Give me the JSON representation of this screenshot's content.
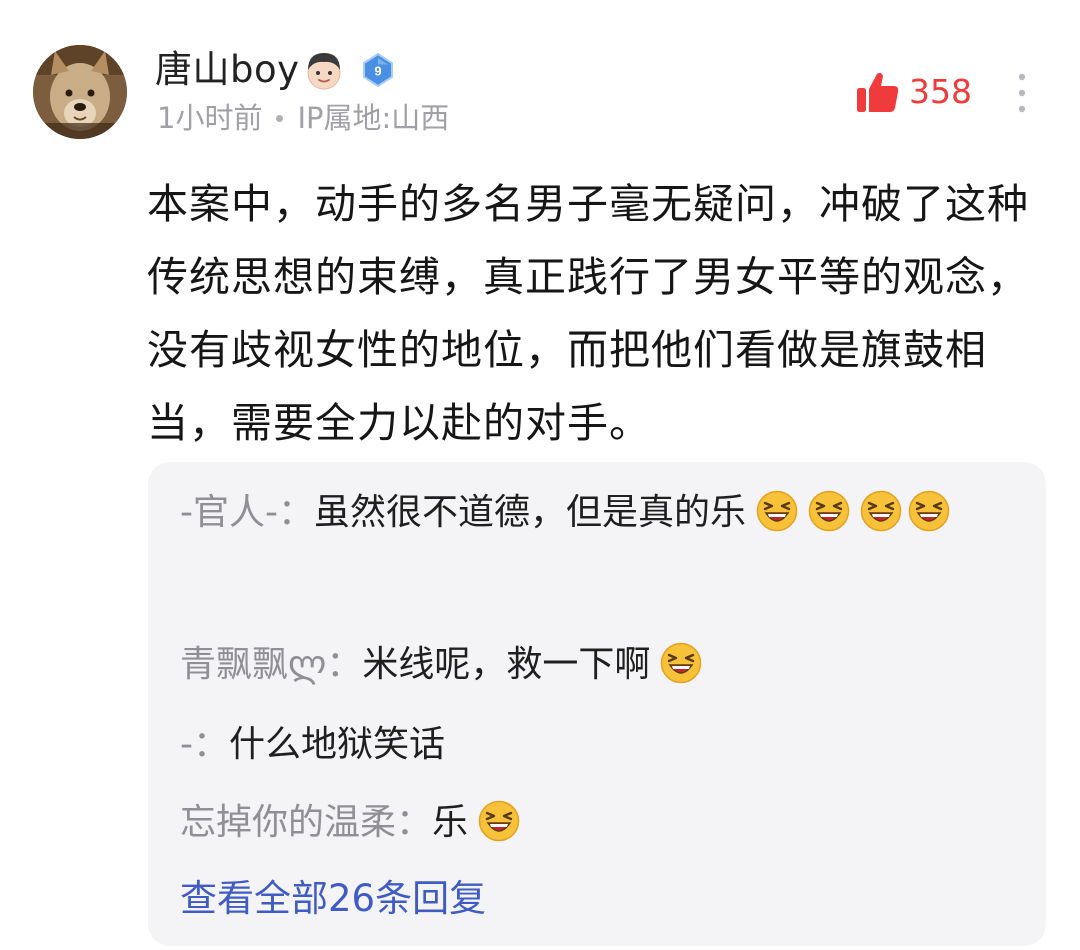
{
  "comment": {
    "username": "唐山boy",
    "level_badge": "9",
    "time": "1小时前",
    "ip_location": "IP属地:山西",
    "like_count": "358",
    "text": "本案中，动手的多名男子毫无疑问，冲破了这种传统思想的束缚，真正践行了男女平等的观念，没有歧视女性的地位，而把他们看做是旗鼓相当，需要全力以赴的对手。"
  },
  "replies": [
    {
      "author": "-官人-",
      "separator": "：",
      "text": "虽然很不道德，但是真的乐"
    },
    {
      "author": "青飘飘ლ",
      "separator": "：",
      "text": "米线呢，救一下啊"
    },
    {
      "author": "-",
      "separator": "：",
      "text": "什么地狱笑话"
    },
    {
      "author": "忘掉你的温柔",
      "separator": "：",
      "text": "乐"
    }
  ],
  "view_all_label": "查看全部26条回复",
  "icons": {
    "avatar": "dog-avatar",
    "name_emoji": "boy-face-icon",
    "level": "diamond-level-icon",
    "like": "thumbs-up-icon",
    "more": "more-vertical-icon",
    "reply_emoji": "laughing-face-icon"
  },
  "colors": {
    "like": "#ef3b3b",
    "link": "#3f5bc4",
    "meta": "#a0a0a6",
    "reply_bg": "#f4f4f6",
    "level_badge": "#4a90e2"
  }
}
